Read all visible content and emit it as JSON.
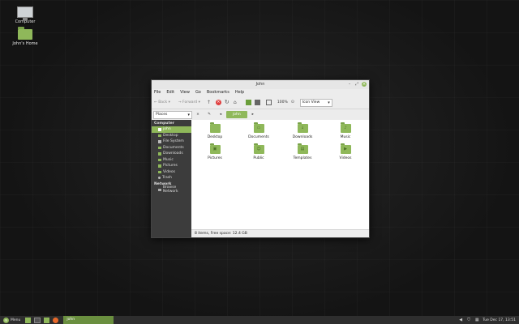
{
  "desktop": {
    "icons": [
      {
        "label": "Computer"
      },
      {
        "label": "John's Home"
      }
    ]
  },
  "window": {
    "title": "John",
    "menu": [
      "File",
      "Edit",
      "View",
      "Go",
      "Bookmarks",
      "Help"
    ],
    "toolbar": {
      "back": "Back",
      "forward": "Forward",
      "zoom": "100%",
      "view_mode": "Icon View"
    },
    "pathbar": {
      "places": "Places",
      "crumb": "john"
    },
    "sidebar": {
      "computer_header": "Computer",
      "computer_items": [
        "john",
        "Desktop",
        "File System",
        "Documents",
        "Downloads",
        "Music",
        "Pictures",
        "Videos",
        "Trash"
      ],
      "network_header": "Network",
      "network_items": [
        "Browse Network"
      ]
    },
    "files": [
      "Desktop",
      "Documents",
      "Downloads",
      "Music",
      "Pictures",
      "Public",
      "Templates",
      "Videos"
    ],
    "status": "8 items, Free space: 12.4 GB"
  },
  "panel": {
    "menu_label": "Menu",
    "task_label": "john",
    "clock": "Tue Dec 17, 13:51"
  }
}
